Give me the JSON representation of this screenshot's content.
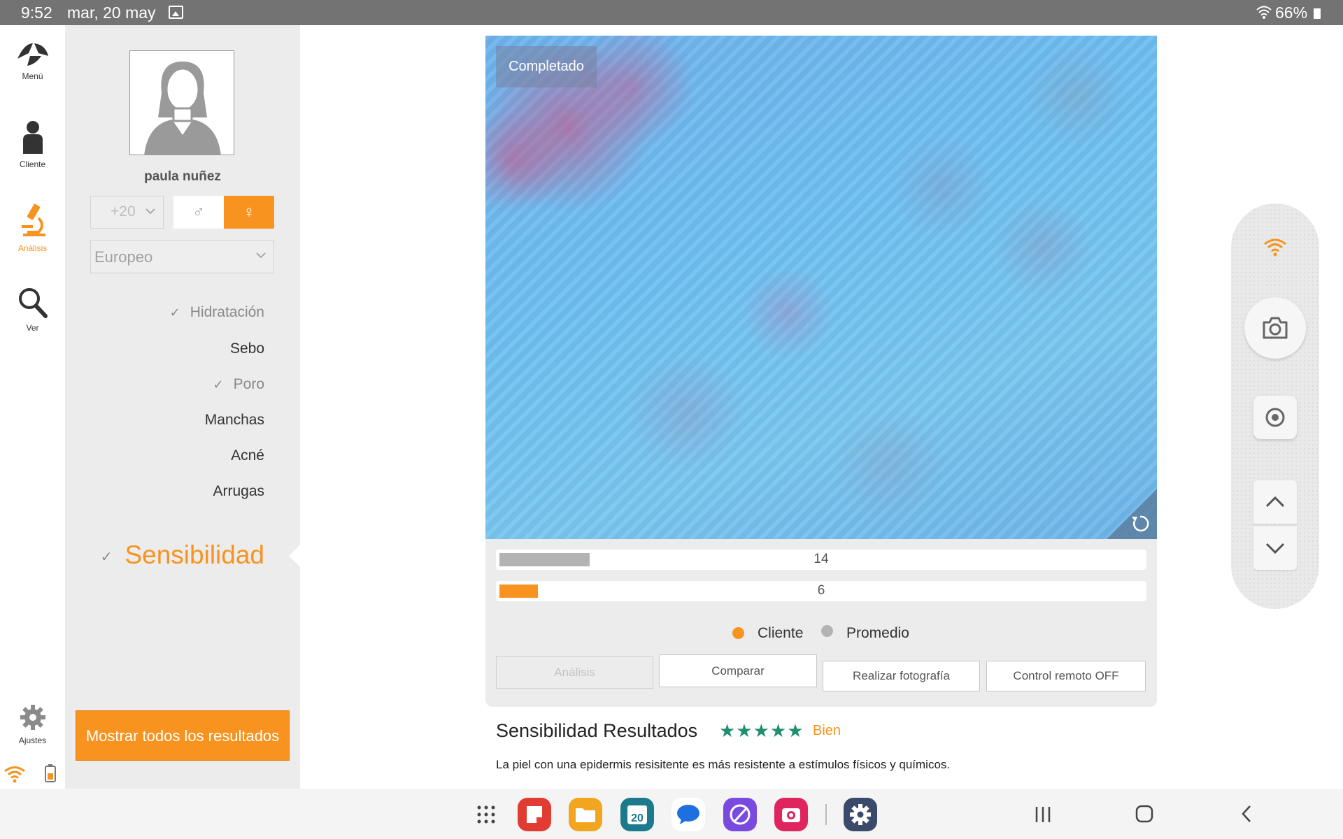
{
  "status_bar": {
    "time": "9:52",
    "date": "mar, 20 may",
    "battery": "66%"
  },
  "rail": {
    "items": [
      {
        "label": "Menú",
        "icon": "logo-icon"
      },
      {
        "label": "Cliente",
        "icon": "person-icon"
      },
      {
        "label": "Análisis",
        "icon": "microscope-icon",
        "active": true
      },
      {
        "label": "Ver",
        "icon": "search-icon"
      },
      {
        "label": "Ajustes",
        "icon": "gear-icon"
      }
    ]
  },
  "client": {
    "name": "paula nuñez",
    "age": "+20",
    "gender_male_symbol": "♂",
    "gender_female_symbol": "♀",
    "gender_selected": "female",
    "ethnicity": "Europeo"
  },
  "metrics": [
    {
      "label": "Hidratación",
      "done": true
    },
    {
      "label": "Sebo",
      "done": false
    },
    {
      "label": "Poro",
      "done": true
    },
    {
      "label": "Manchas",
      "done": false
    },
    {
      "label": "Acné",
      "done": false
    },
    {
      "label": "Arrugas",
      "done": false
    },
    {
      "label": "Sensibilidad",
      "done": true,
      "active": true
    }
  ],
  "show_all_button": "Mostrar todos los resultados",
  "analysis": {
    "status": "Completado",
    "bars": [
      {
        "value": "14",
        "fill": 0.14,
        "color": "#b3b3b3"
      },
      {
        "value": "6",
        "fill": 0.06,
        "color": "#f7931e"
      }
    ],
    "legend": [
      {
        "label": "Cliente",
        "color": "#f7931e"
      },
      {
        "label": "Promedio",
        "color": "#b3b3b3"
      }
    ],
    "buttons": {
      "analysis": "Análisis",
      "compare": "Comparar",
      "photo": "Realizar fotografía",
      "remote": "Control remoto OFF"
    }
  },
  "results": {
    "title": "Sensibilidad Resultados",
    "stars": "★★★★★",
    "rating": "Bien",
    "description": "La piel con una epidermis resisitente es más resistente a estímulos físicos y químicos."
  },
  "dock": {
    "calendar_day": "20"
  },
  "colors": {
    "accent": "#f7931e",
    "panel": "#ececec",
    "star": "#1f8f6f"
  }
}
